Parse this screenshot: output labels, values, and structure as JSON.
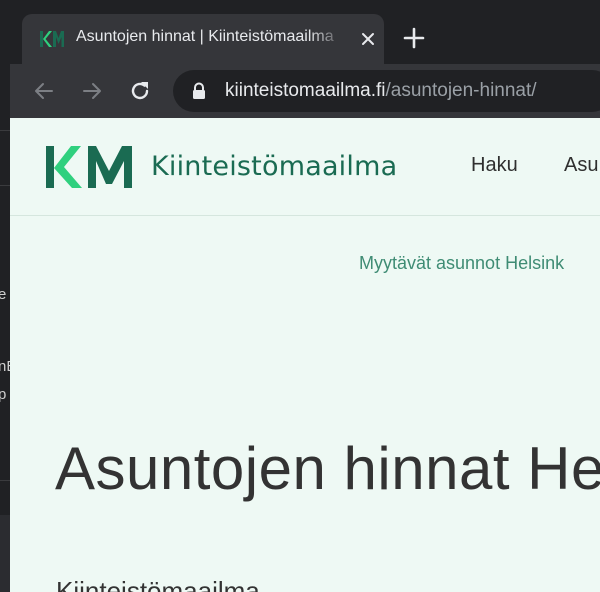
{
  "background_app": {
    "fragments": [
      "e",
      "nE",
      "p"
    ]
  },
  "browser": {
    "tab": {
      "title": "Asuntojen hinnat | Kiinteistömaailma"
    },
    "address_bar": {
      "host": "kiinteistomaailma.fi",
      "path": "/asuntojen-hinnat/"
    }
  },
  "site": {
    "logo_text": "Kiinteistömaailma",
    "nav": [
      "Haku",
      "Asu"
    ],
    "promo_link": "Myytävät asunnot Helsink",
    "heading": "Asuntojen hinnat He",
    "body_fragment": "Kiinteistömaailma"
  },
  "colors": {
    "brand_green": "#1a6b52",
    "brand_light_green": "#2fd07e",
    "page_bg": "#eef9f4",
    "chrome_dark": "#202124",
    "chrome_mid": "#35363a"
  }
}
